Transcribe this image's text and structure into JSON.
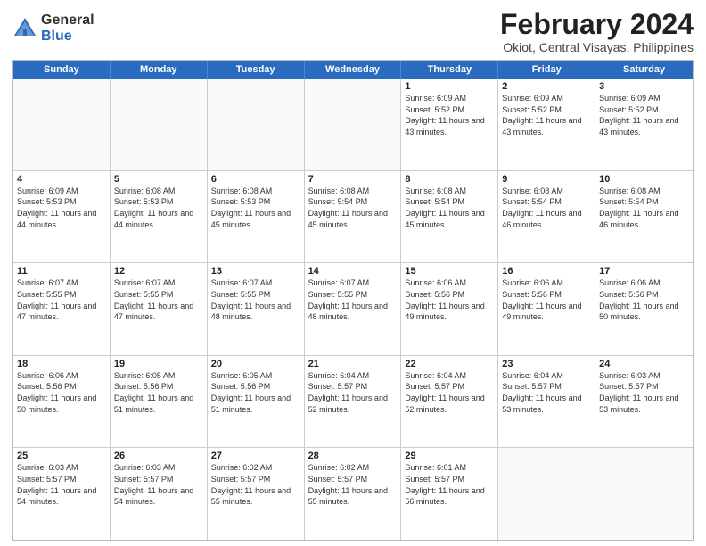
{
  "logo": {
    "general": "General",
    "blue": "Blue"
  },
  "title": "February 2024",
  "subtitle": "Okiot, Central Visayas, Philippines",
  "days": [
    "Sunday",
    "Monday",
    "Tuesday",
    "Wednesday",
    "Thursday",
    "Friday",
    "Saturday"
  ],
  "rows": [
    [
      {
        "day": "",
        "info": ""
      },
      {
        "day": "",
        "info": ""
      },
      {
        "day": "",
        "info": ""
      },
      {
        "day": "",
        "info": ""
      },
      {
        "day": "1",
        "info": "Sunrise: 6:09 AM\nSunset: 5:52 PM\nDaylight: 11 hours and 43 minutes."
      },
      {
        "day": "2",
        "info": "Sunrise: 6:09 AM\nSunset: 5:52 PM\nDaylight: 11 hours and 43 minutes."
      },
      {
        "day": "3",
        "info": "Sunrise: 6:09 AM\nSunset: 5:52 PM\nDaylight: 11 hours and 43 minutes."
      }
    ],
    [
      {
        "day": "4",
        "info": "Sunrise: 6:09 AM\nSunset: 5:53 PM\nDaylight: 11 hours and 44 minutes."
      },
      {
        "day": "5",
        "info": "Sunrise: 6:08 AM\nSunset: 5:53 PM\nDaylight: 11 hours and 44 minutes."
      },
      {
        "day": "6",
        "info": "Sunrise: 6:08 AM\nSunset: 5:53 PM\nDaylight: 11 hours and 45 minutes."
      },
      {
        "day": "7",
        "info": "Sunrise: 6:08 AM\nSunset: 5:54 PM\nDaylight: 11 hours and 45 minutes."
      },
      {
        "day": "8",
        "info": "Sunrise: 6:08 AM\nSunset: 5:54 PM\nDaylight: 11 hours and 45 minutes."
      },
      {
        "day": "9",
        "info": "Sunrise: 6:08 AM\nSunset: 5:54 PM\nDaylight: 11 hours and 46 minutes."
      },
      {
        "day": "10",
        "info": "Sunrise: 6:08 AM\nSunset: 5:54 PM\nDaylight: 11 hours and 46 minutes."
      }
    ],
    [
      {
        "day": "11",
        "info": "Sunrise: 6:07 AM\nSunset: 5:55 PM\nDaylight: 11 hours and 47 minutes."
      },
      {
        "day": "12",
        "info": "Sunrise: 6:07 AM\nSunset: 5:55 PM\nDaylight: 11 hours and 47 minutes."
      },
      {
        "day": "13",
        "info": "Sunrise: 6:07 AM\nSunset: 5:55 PM\nDaylight: 11 hours and 48 minutes."
      },
      {
        "day": "14",
        "info": "Sunrise: 6:07 AM\nSunset: 5:55 PM\nDaylight: 11 hours and 48 minutes."
      },
      {
        "day": "15",
        "info": "Sunrise: 6:06 AM\nSunset: 5:56 PM\nDaylight: 11 hours and 49 minutes."
      },
      {
        "day": "16",
        "info": "Sunrise: 6:06 AM\nSunset: 5:56 PM\nDaylight: 11 hours and 49 minutes."
      },
      {
        "day": "17",
        "info": "Sunrise: 6:06 AM\nSunset: 5:56 PM\nDaylight: 11 hours and 50 minutes."
      }
    ],
    [
      {
        "day": "18",
        "info": "Sunrise: 6:06 AM\nSunset: 5:56 PM\nDaylight: 11 hours and 50 minutes."
      },
      {
        "day": "19",
        "info": "Sunrise: 6:05 AM\nSunset: 5:56 PM\nDaylight: 11 hours and 51 minutes."
      },
      {
        "day": "20",
        "info": "Sunrise: 6:05 AM\nSunset: 5:56 PM\nDaylight: 11 hours and 51 minutes."
      },
      {
        "day": "21",
        "info": "Sunrise: 6:04 AM\nSunset: 5:57 PM\nDaylight: 11 hours and 52 minutes."
      },
      {
        "day": "22",
        "info": "Sunrise: 6:04 AM\nSunset: 5:57 PM\nDaylight: 11 hours and 52 minutes."
      },
      {
        "day": "23",
        "info": "Sunrise: 6:04 AM\nSunset: 5:57 PM\nDaylight: 11 hours and 53 minutes."
      },
      {
        "day": "24",
        "info": "Sunrise: 6:03 AM\nSunset: 5:57 PM\nDaylight: 11 hours and 53 minutes."
      }
    ],
    [
      {
        "day": "25",
        "info": "Sunrise: 6:03 AM\nSunset: 5:57 PM\nDaylight: 11 hours and 54 minutes."
      },
      {
        "day": "26",
        "info": "Sunrise: 6:03 AM\nSunset: 5:57 PM\nDaylight: 11 hours and 54 minutes."
      },
      {
        "day": "27",
        "info": "Sunrise: 6:02 AM\nSunset: 5:57 PM\nDaylight: 11 hours and 55 minutes."
      },
      {
        "day": "28",
        "info": "Sunrise: 6:02 AM\nSunset: 5:57 PM\nDaylight: 11 hours and 55 minutes."
      },
      {
        "day": "29",
        "info": "Sunrise: 6:01 AM\nSunset: 5:57 PM\nDaylight: 11 hours and 56 minutes."
      },
      {
        "day": "",
        "info": ""
      },
      {
        "day": "",
        "info": ""
      }
    ]
  ]
}
